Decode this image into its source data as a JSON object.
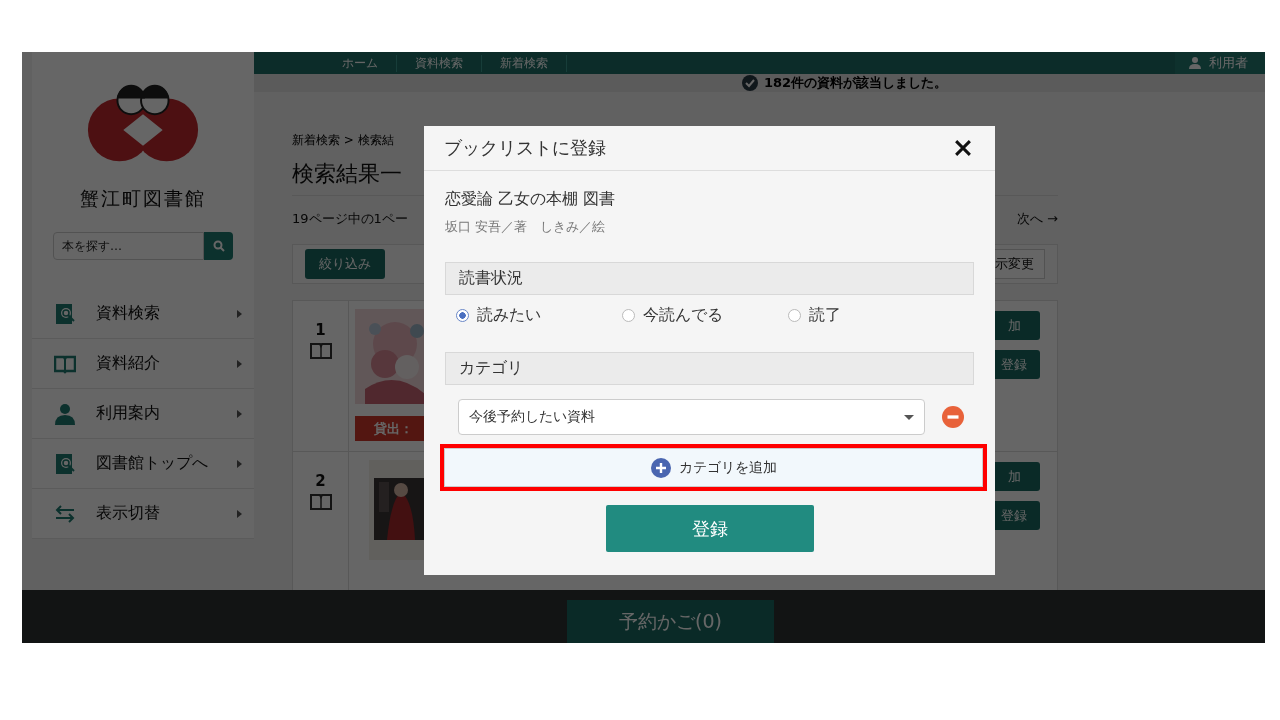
{
  "nav": {
    "items": [
      "ホーム",
      "資料検索",
      "新着検索"
    ],
    "user": "利用者"
  },
  "notice": "182件の資料が該当しました。",
  "sidebar": {
    "library_name": "蟹江町図書館",
    "search": {
      "placeholder": "本を探す…"
    },
    "menu": [
      {
        "label": "資料検索",
        "kind": "search"
      },
      {
        "label": "資料紹介",
        "kind": "book"
      },
      {
        "label": "利用案内",
        "kind": "user"
      },
      {
        "label": "図書館トップへ",
        "kind": "search"
      },
      {
        "label": "表示切替",
        "kind": "switch"
      }
    ]
  },
  "content": {
    "breadcrumb": "新着検索 > 検索結",
    "heading": "検索結果一",
    "page_info": "19ページ中の1ペー",
    "next": "次へ →",
    "filter_button": "絞り込み",
    "display_button": "示変更",
    "results": [
      {
        "number": "1",
        "status": "貸出：",
        "buttons": [
          "加",
          "登録"
        ]
      },
      {
        "number": "2",
        "buttons": [
          "加",
          "登録"
        ]
      }
    ]
  },
  "cart_button": "予約かご(0)",
  "dialog": {
    "title": "ブックリストに登録",
    "book_title": "恋愛論 乙女の本棚 図書",
    "authors": "坂口 安吾／著　しきみ／絵",
    "reading_status": {
      "heading": "読書状況",
      "options": [
        {
          "label": "読みたい",
          "selected": true
        },
        {
          "label": "今読んでる",
          "selected": false
        },
        {
          "label": "読了",
          "selected": false
        }
      ]
    },
    "category": {
      "heading": "カテゴリ",
      "value": "今後予約したい資料",
      "add_button": "カテゴリを追加",
      "highlighted": true
    },
    "submit_button": "登録"
  }
}
